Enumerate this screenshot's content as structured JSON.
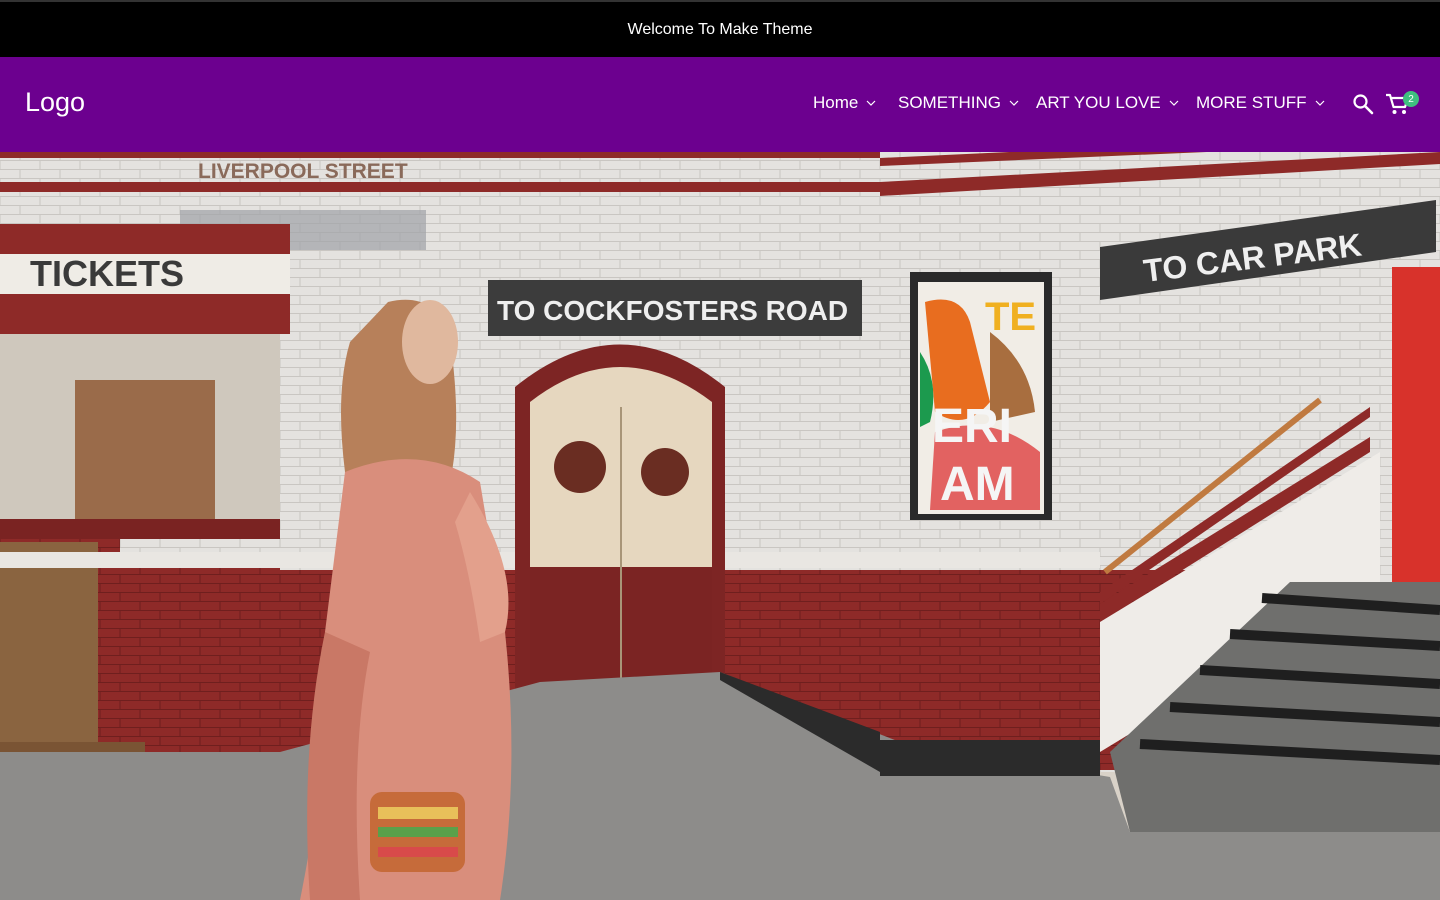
{
  "announcement": {
    "text": "Welcome To Make Theme"
  },
  "header": {
    "logo": "Logo",
    "background": "#6c008f",
    "nav": [
      {
        "label": "Home",
        "icon": "chevron-down-icon"
      },
      {
        "label": "SOMETHING",
        "icon": "chevron-down-icon"
      },
      {
        "label": "ART YOU LOVE",
        "icon": "chevron-down-icon"
      },
      {
        "label": "MORE STUFF",
        "icon": "chevron-down-icon"
      }
    ],
    "search_icon": "search-icon",
    "cart_icon": "cart-icon",
    "cart_count": "2",
    "badge_color": "#3fbf7f"
  },
  "hero": {
    "signs": {
      "station": "LIVERPOOL STREET",
      "tickets": "TICKETS",
      "door": "TO COCKFOSTERS ROAD",
      "car_park": "TO CAR PARK",
      "poster_a": "ERI",
      "poster_b": "AM",
      "poster_c": "TE"
    }
  }
}
